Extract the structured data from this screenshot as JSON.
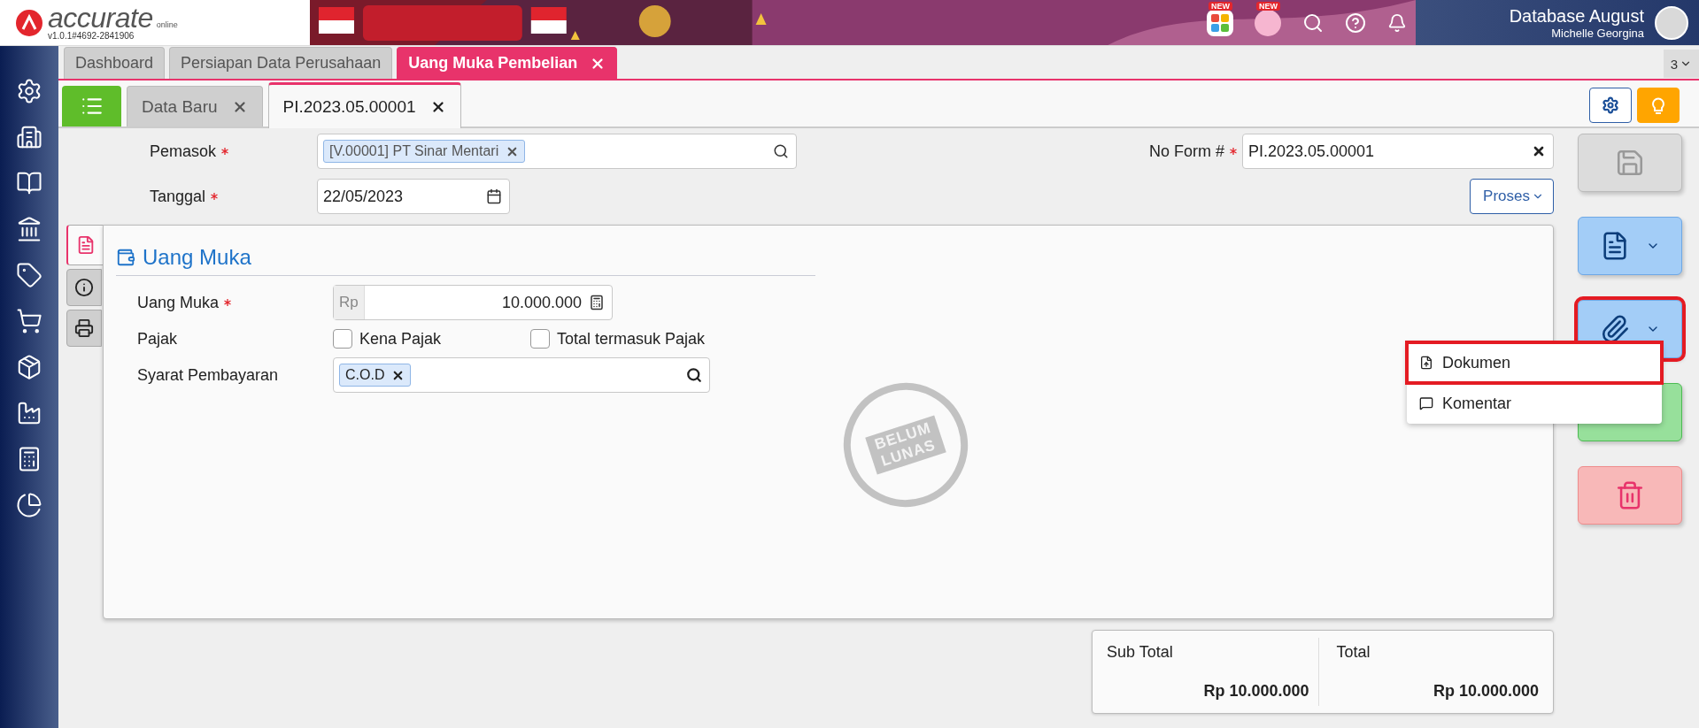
{
  "header": {
    "logo": "accurate",
    "logo_sub": "online",
    "version": "v1.0.1#4692-2841906",
    "apps": [
      {
        "kind": "apps",
        "badge": "NEW"
      },
      {
        "kind": "character",
        "badge": "NEW"
      }
    ],
    "database": "Database August",
    "user": "Michelle Georgina"
  },
  "main_tabs": [
    {
      "label": "Dashboard",
      "selected": false,
      "closable": false
    },
    {
      "label": "Persiapan Data Perusahaan",
      "selected": false,
      "closable": false
    },
    {
      "label": "Uang Muka Pembelian",
      "selected": true,
      "closable": true
    }
  ],
  "tab_count": "3",
  "doc_tabs": [
    {
      "label": "Data Baru",
      "selected": false
    },
    {
      "label": "PI.2023.05.00001",
      "selected": true
    }
  ],
  "form": {
    "supplier": {
      "label": "Pemasok",
      "required": true,
      "tag": "[V.00001] PT Sinar Mentari"
    },
    "date": {
      "label": "Tanggal",
      "required": true,
      "value": "22/05/2023"
    },
    "form_no": {
      "label": "No Form #",
      "required": true,
      "value": "PI.2023.05.00001"
    },
    "process_button": "Proses"
  },
  "side_tabs": [
    {
      "kind": "document",
      "selected": true
    },
    {
      "kind": "info",
      "selected": false
    },
    {
      "kind": "printer",
      "selected": false
    }
  ],
  "section": {
    "title": "Uang Muka",
    "down_payment": {
      "label": "Uang Muka",
      "required": true,
      "currency": "Rp",
      "value": "10.000.000"
    },
    "tax": {
      "label": "Pajak",
      "options": [
        {
          "label": "Kena Pajak",
          "checked": false
        },
        {
          "label": "Total termasuk Pajak",
          "checked": false
        }
      ]
    },
    "terms": {
      "label": "Syarat Pembayaran",
      "tag": "C.O.D"
    },
    "stamp": [
      "BELUM",
      "LUNAS"
    ]
  },
  "actions": [
    {
      "kind": "save",
      "highlighted": false
    },
    {
      "kind": "document",
      "highlighted": false
    },
    {
      "kind": "attach",
      "highlighted": true
    },
    {
      "kind": "approve",
      "highlighted": false
    },
    {
      "kind": "delete",
      "highlighted": false
    }
  ],
  "menu": {
    "items": [
      {
        "kind": "upload",
        "label": "Dokumen",
        "highlighted": true
      },
      {
        "kind": "comment",
        "label": "Komentar",
        "highlighted": false
      }
    ]
  },
  "totals": [
    {
      "label": "Sub Total",
      "value": "Rp 10.000.000"
    },
    {
      "label": "Total",
      "value": "Rp 10.000.000"
    }
  ]
}
